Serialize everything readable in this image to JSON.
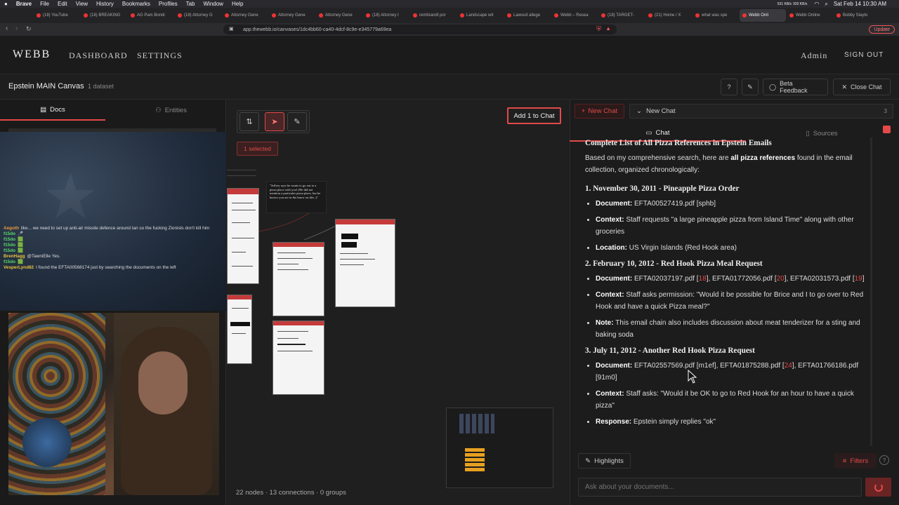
{
  "menubar": {
    "items": [
      "Brave",
      "File",
      "Edit",
      "View",
      "History",
      "Bookmarks",
      "Profiles",
      "Tab",
      "Window",
      "Help"
    ],
    "net_up": "531 KB/s",
    "net_down": "920 KB/s",
    "clock": "Sat Feb 14  10:30 AM"
  },
  "tabs": [
    {
      "label": "(18) YouTube",
      "active": false
    },
    {
      "label": "(18) BREAKING",
      "active": false
    },
    {
      "label": "AG Pam Bondi",
      "active": false
    },
    {
      "label": "(18) Attorney G",
      "active": false
    },
    {
      "label": "Attorney Gene",
      "active": false
    },
    {
      "label": "Attorney Gene",
      "active": false
    },
    {
      "label": "Attorney Gene",
      "active": false
    },
    {
      "label": "(18) Attorney I",
      "active": false
    },
    {
      "label": "rembrandt por",
      "active": false
    },
    {
      "label": "Landscape wit",
      "active": false
    },
    {
      "label": "Lawsuit allege",
      "active": false
    },
    {
      "label": "Webb – Resea",
      "active": false
    },
    {
      "label": "(18) TARGET-",
      "active": false
    },
    {
      "label": "(21) Home / X",
      "active": false
    },
    {
      "label": "what was spe",
      "active": false
    },
    {
      "label": "Webb Onli",
      "active": true
    },
    {
      "label": "Webb Online",
      "active": false
    },
    {
      "label": "Bobby Slayto",
      "active": false
    }
  ],
  "urlbar": {
    "url": "app.thewebb.io/canvases/1dc4bb60-ca40-4dcf-8c9e-e345779a69ea",
    "update_label": "Update"
  },
  "app": {
    "logo": "WEBB",
    "nav": [
      "DASHBOARD",
      "SETTINGS"
    ],
    "user": "Admin",
    "signout": "SIGN OUT"
  },
  "subheader": {
    "canvas_title": "Epstein MAIN Canvas",
    "dataset_count": "1 dataset",
    "beta_feedback": "Beta Feedback",
    "close_chat": "Close Chat"
  },
  "left": {
    "tabs": [
      "Docs",
      "Entities"
    ],
    "chat": [
      {
        "user": "Aegoth",
        "color": "#e89a3c",
        "text": "like... we need to set up anti-air missile defence around Ian so the fucking Zionists don't kill him"
      },
      {
        "user": "f15do",
        "color": "#5ad86a",
        "text": "🎤"
      },
      {
        "user": "f15do",
        "color": "#5ad86a",
        "text": "🟩"
      },
      {
        "user": "f15do",
        "color": "#5ad86a",
        "text": "🟩"
      },
      {
        "user": "f15do",
        "color": "#5ad86a",
        "text": "🟩"
      },
      {
        "user": "BrenHagg",
        "color": "#e8c23c",
        "text": "@TawniElle Yes."
      },
      {
        "user": "f15do",
        "color": "#5ad86a",
        "text": "🟩"
      },
      {
        "user": "VesperLynd82",
        "color": "#e8c23c",
        "text": "I found the EFTA00568174 just by searching the documents on the left"
      }
    ]
  },
  "canvas": {
    "add_to_chat": "Add 1 to Chat",
    "selected": "1 selected",
    "quote": "\"Jeffrey says he wants to go out to a pizza place with you! (He did not mention a particular pizza place, but he knows you are in the know on this ;)\"",
    "stats": "22 nodes · 13 connections · 0 groups"
  },
  "chat": {
    "new_chat_btn": "New Chat",
    "session": "New Chat",
    "session_count": "3",
    "tabs": [
      "Chat",
      "Sources"
    ],
    "heading": "Complete List of All Pizza References in Epstein Emails",
    "intro_pre": "Based on my comprehensive search, here are ",
    "intro_bold": "all pizza references",
    "intro_post": " found in the email collection, organized chronologically:",
    "sections": [
      {
        "title": "1. November 30, 2011 - Pineapple Pizza Order",
        "items": [
          {
            "label": "Document:",
            "text": "EFTA00527419.pdf [sphb]"
          },
          {
            "label": "Context:",
            "text": "Staff requests \"a large pineapple pizza from Island Time\" along with other groceries"
          },
          {
            "label": "Location:",
            "text": "US Virgin Islands (Red Hook area)"
          }
        ]
      },
      {
        "title": "2. February 10, 2012 - Red Hook Pizza Meal Request",
        "items": [
          {
            "label": "Document:",
            "text": "EFTA02037197.pdf [18], EFTA01772056.pdf [20], EFTA02031573.pdf [19]"
          },
          {
            "label": "Context:",
            "text": "Staff asks permission: \"Would it be possible for Brice and I to go over to Red Hook and have a quick Pizza meal?\""
          },
          {
            "label": "Note:",
            "text": "This email chain also includes discussion about meat tenderizer for a sting and baking soda"
          }
        ]
      },
      {
        "title": "3. July 11, 2012 - Another Red Hook Pizza Request",
        "items": [
          {
            "label": "Document:",
            "text": "EFTA02557569.pdf [m1ef], EFTA01875288.pdf [24], EFTA01766186.pdf [91m0]"
          },
          {
            "label": "Context:",
            "text": "Staff asks: \"Would it be OK to go to Red Hook for an hour to have a quick pizza\""
          },
          {
            "label": "Response:",
            "text": "Epstein simply replies \"ok\""
          }
        ]
      }
    ],
    "highlights": "Highlights",
    "filters": "Filters",
    "input_placeholder": "Ask about your documents..."
  },
  "colors": {
    "accent": "#e24a4a",
    "bg": "#1c1c1c"
  }
}
